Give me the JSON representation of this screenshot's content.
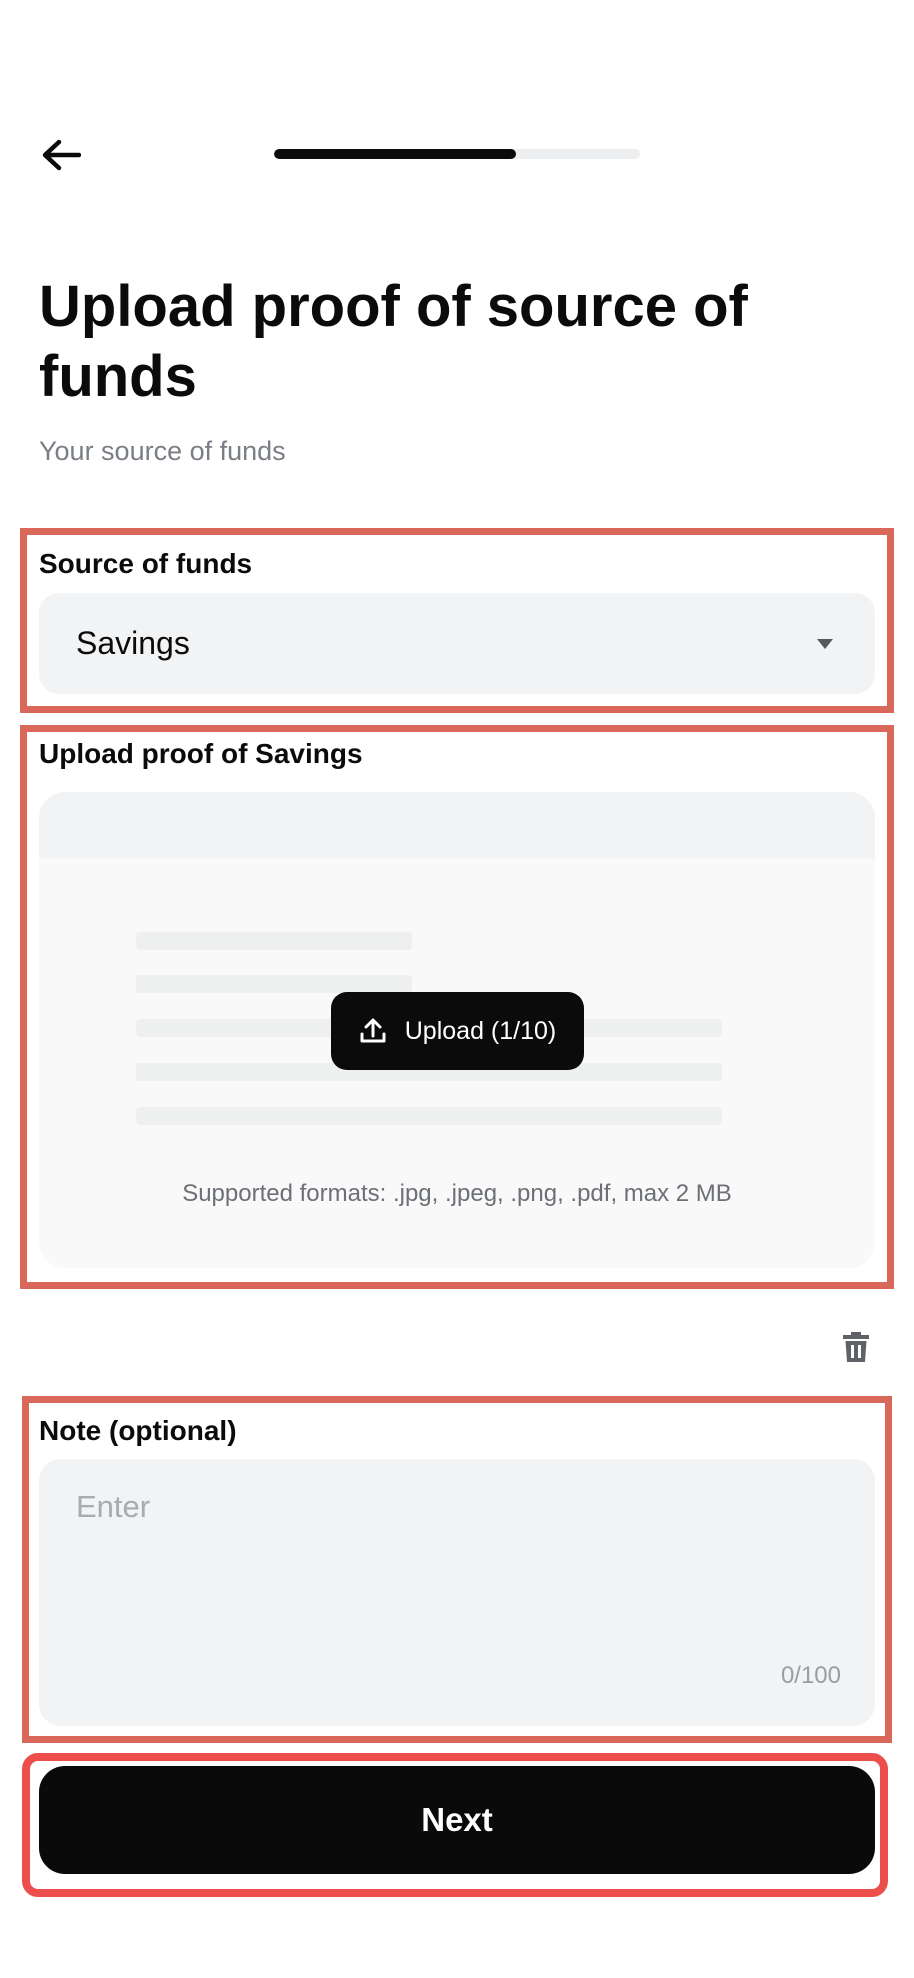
{
  "header": {
    "back_icon": "arrow-left-icon",
    "progress": 0.66
  },
  "title": "Upload proof of source of funds",
  "subtitle": "Your source of funds",
  "source_field": {
    "label": "Source of funds",
    "value": "Savings",
    "dropdown_icon": "caret-down-icon"
  },
  "upload": {
    "label": "Upload proof of Savings",
    "button_label": "Upload (1/10)",
    "button_icon": "upload-icon",
    "formats": "Supported formats: .jpg, .jpeg, .png, .pdf, max 2 MB"
  },
  "delete_icon": "trash-icon",
  "note": {
    "label": "Note (optional)",
    "placeholder": "Enter",
    "value": "",
    "counter": "0/100"
  },
  "next_label": "Next",
  "colors": {
    "primary": "#0b0b0b",
    "field_bg": "#f1f3f4",
    "subtitle": "#7a7f85",
    "highlight": "#d9685a",
    "highlight_strong": "#ec4f4b"
  }
}
